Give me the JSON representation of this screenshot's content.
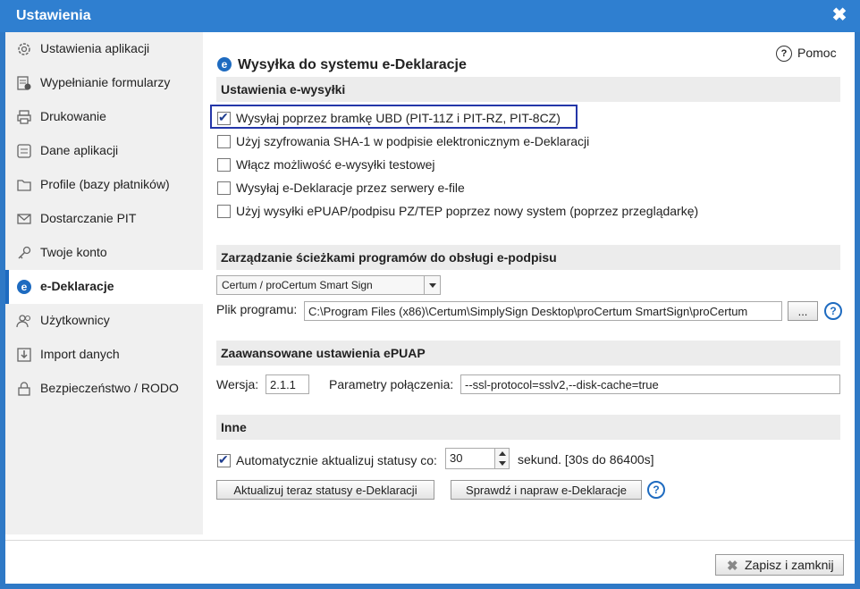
{
  "window": {
    "title": "Ustawienia"
  },
  "sidebar": {
    "items": [
      {
        "label": "Ustawienia aplikacji",
        "icon": "gear-icon"
      },
      {
        "label": "Wypełnianie formularzy",
        "icon": "form-fill-icon"
      },
      {
        "label": "Drukowanie",
        "icon": "printer-icon"
      },
      {
        "label": "Dane aplikacji",
        "icon": "data-icon"
      },
      {
        "label": "Profile (bazy płatników)",
        "icon": "folder-icon"
      },
      {
        "label": "Dostarczanie PIT",
        "icon": "envelope-icon"
      },
      {
        "label": "Twoje konto",
        "icon": "key-icon"
      },
      {
        "label": "e-Deklaracje",
        "icon": "e-declaration-icon",
        "active": true
      },
      {
        "label": "Użytkownicy",
        "icon": "users-icon"
      },
      {
        "label": "Import danych",
        "icon": "import-icon"
      },
      {
        "label": "Bezpieczeństwo / RODO",
        "icon": "lock-icon"
      }
    ]
  },
  "main": {
    "heading": "Wysyłka do systemu e-Deklaracje",
    "help_label": "Pomoc",
    "sections": {
      "sending": "Ustawienia e-wysyłki",
      "paths": "Zarządzanie ścieżkami programów do obsługi e-podpisu",
      "epuap": "Zaawansowane ustawienia ePUAP",
      "other": "Inne"
    },
    "checkboxes": [
      {
        "label": "Wysyłaj poprzez bramkę UBD (PIT-11Z i PIT-RZ, PIT-8CZ)",
        "checked": true
      },
      {
        "label": "Użyj szyfrowania SHA-1 w podpisie elektronicznym e-Deklaracji",
        "checked": false
      },
      {
        "label": "Włącz możliwość e-wysyłki testowej",
        "checked": false
      },
      {
        "label": "Wysyłaj e-Deklaracje przez serwery e-file",
        "checked": false
      },
      {
        "label": "Użyj wysyłki ePUAP/podpisu PZ/TEP poprzez nowy system (poprzez przeglądarkę)",
        "checked": false
      }
    ],
    "signer_select": "Certum / proCertum Smart Sign",
    "program_file_label": "Plik programu:",
    "program_file_value": "C:\\Program Files (x86)\\Certum\\SimplySign Desktop\\proCertum SmartSign\\proCertum",
    "browse_label": "...",
    "version_label": "Wersja:",
    "version_value": "2.1.1",
    "params_label": "Parametry połączenia:",
    "params_value": "--ssl-protocol=sslv2,--disk-cache=true",
    "auto_update_label": "Automatycznie aktualizuj statusy co:",
    "auto_update_checked": true,
    "auto_update_value": "30",
    "auto_update_unit": "sekund. [30s do 86400s]",
    "refresh_button": "Aktualizuj teraz statusy e-Deklaracji",
    "repair_button": "Sprawdź i napraw e-Deklaracje"
  },
  "footer": {
    "save_close": "Zapisz i zamknij"
  },
  "colors": {
    "titlebar": "#2f7fd0",
    "accent": "#1e6bc0",
    "focus": "#2436a8"
  }
}
